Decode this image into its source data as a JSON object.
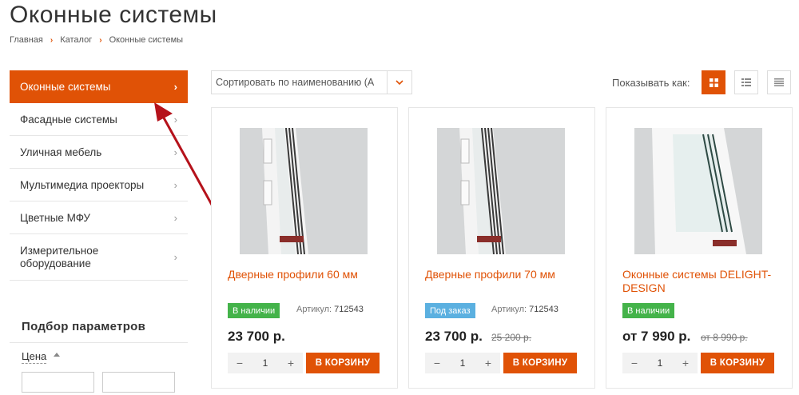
{
  "page": {
    "title": "Оконные системы"
  },
  "breadcrumb": [
    "Главная",
    "Каталог",
    "Оконные системы"
  ],
  "sidebar": {
    "items": [
      {
        "label": "Оконные системы",
        "active": true
      },
      {
        "label": "Фасадные системы"
      },
      {
        "label": "Уличная мебель"
      },
      {
        "label": "Мультимедиа проекторы"
      },
      {
        "label": "Цветные МФУ"
      },
      {
        "label": "Измерительное оборудование"
      }
    ]
  },
  "filter": {
    "title": "Подбор параметров",
    "price_label": "Цена"
  },
  "toolbar": {
    "sort_text": "Сортировать по наименованию (А",
    "show_label": "Показывать как:"
  },
  "colors": {
    "accent": "#e05206",
    "in_stock": "#44b34a",
    "on_order": "#5bb0e0"
  },
  "products": [
    {
      "name": "Дверные профили 60 мм",
      "badge": "В наличии",
      "sku_label": "Артикул:",
      "sku": "712543",
      "price": "23 700 р.",
      "old_price": "",
      "qty": "1",
      "cart": "В КОРЗИНУ"
    },
    {
      "name": "Дверные профили 70 мм",
      "badge": "Под заказ",
      "sku_label": "Артикул:",
      "sku": "712543",
      "price": "23 700 р.",
      "old_price": "25 200 р.",
      "qty": "1",
      "cart": "В КОРЗИНУ"
    },
    {
      "name": "Оконные системы DELIGHT-DESIGN",
      "badge": "В наличии",
      "sku_label": "",
      "sku": "",
      "price": "от 7 990 р.",
      "old_price": "от 8 990 р.",
      "qty": "1",
      "cart": "В КОРЗИНУ"
    }
  ],
  "icons": {
    "qty_minus": "−",
    "qty_plus": "+",
    "chevron": "›"
  }
}
